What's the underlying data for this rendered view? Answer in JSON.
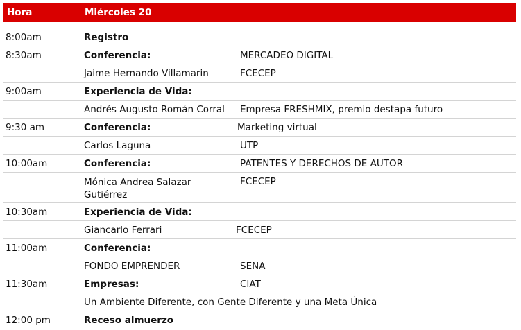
{
  "header": {
    "hora": "Hora",
    "day": "Miércoles 20"
  },
  "rows": [
    {
      "time": "8:00am",
      "title": "Registro"
    },
    {
      "time": "8:30am",
      "title": "Conferencia:",
      "value": "MERCADEO DIGITAL"
    },
    {
      "name": "Jaime Hernando Villamarin",
      "value": "FCECEP"
    },
    {
      "time": "9:00am",
      "title": "Experiencia de Vida:"
    },
    {
      "name": "Andrés Augusto Román Corral",
      "value": "Empresa FRESHMIX, premio destapa futuro"
    },
    {
      "time": "9:30 am",
      "title": "Conferencia:",
      "value": "Marketing virtual"
    },
    {
      "name": "Carlos Laguna",
      "value": "UTP"
    },
    {
      "time": "10:00am",
      "title": "Conferencia:",
      "value": "PATENTES Y DERECHOS DE AUTOR"
    },
    {
      "name": "Mónica Andrea Salazar Gutiérrez",
      "value": "FCECEP"
    },
    {
      "time": "10:30am",
      "title": "Experiencia de Vida:"
    },
    {
      "name": "Giancarlo Ferrari",
      "value": "FCECEP"
    },
    {
      "time": "11:00am",
      "title": "Conferencia:"
    },
    {
      "name": "FONDO EMPRENDER",
      "value": "SENA"
    },
    {
      "time": "11:30am",
      "title": "Empresas:",
      "value": "CIAT"
    },
    {
      "full": "Un Ambiente Diferente, con Gente Diferente y una Meta Única"
    },
    {
      "time": "12:00 pm",
      "title": "Receso almuerzo"
    }
  ]
}
